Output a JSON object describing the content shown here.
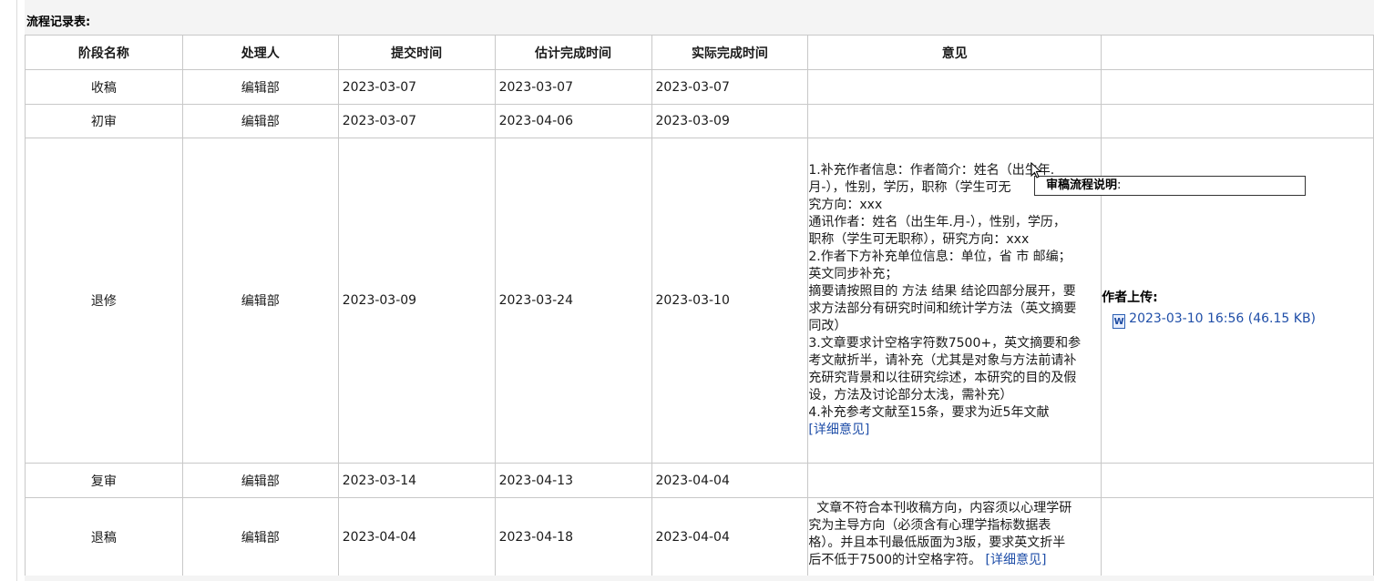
{
  "section_title": "流程记录表:",
  "columns": [
    "阶段名称",
    "处理人",
    "提交时间",
    "估计完成时间",
    "实际完成时间",
    "意见",
    ""
  ],
  "rows": [
    {
      "stage": "收稿",
      "handler": "编辑部",
      "submitted": "2023-03-07",
      "estimated": "2023-03-07",
      "actual": "2023-03-07"
    },
    {
      "stage": "初审",
      "handler": "编辑部",
      "submitted": "2023-03-07",
      "estimated": "2023-04-06",
      "actual": "2023-03-09"
    },
    {
      "stage": "退修",
      "handler": "编辑部",
      "submitted": "2023-03-09",
      "estimated": "2023-03-24",
      "actual": "2023-03-10",
      "opinion_lines": [
        "1.补充作者信息：作者简介：姓名（出生年.",
        "月-），性别，学历，职称（学生可无",
        "究方向：xxx",
        "通讯作者：姓名（出生年.月-），性别，学历，",
        "职称（学生可无职称），研究方向：xxx",
        "2.作者下方补充单位信息：单位，省 市 邮编；",
        "英文同步补充；",
        "摘要请按照目的 方法 结果 结论四部分展开，要",
        "求方法部分有研究时间和统计学方法（英文摘要",
        "同改）",
        "3.文章要求计空格字符数7500+，英文摘要和参",
        "考文献折半，请补充（尤其是对象与方法前请补",
        "充研究背景和以往研究综述，本研究的目的及假",
        "设，方法及讨论部分太浅，需补充）",
        "4.补充参考文献至15条，要求为近5年文献"
      ],
      "detail_link": "[详细意见]",
      "upload_label": "作者上传:",
      "upload_file": "2023-03-10 16:56 (46.15 KB)",
      "upload_icon": "word-doc-icon"
    },
    {
      "stage": "复审",
      "handler": "编辑部",
      "submitted": "2023-03-14",
      "estimated": "2023-04-13",
      "actual": "2023-04-04"
    },
    {
      "stage": "退稿",
      "handler": "编辑部",
      "submitted": "2023-04-04",
      "estimated": "2023-04-18",
      "actual": "2023-04-04",
      "opinion_lines": [
        "  文章不符合本刊收稿方向，内容须以心理学研",
        "究为主导方向（必须含有心理学指标数据表",
        "格）。并且本刊最低版面为3版，要求英文折半",
        "后不低于7500的计空格字符。"
      ],
      "detail_link": "[详细意见]"
    }
  ],
  "tooltip": {
    "title": "审稿流程说明",
    "suffix": ":"
  },
  "colors": {
    "link": "#1f4ea8",
    "border": "#c8c8c8",
    "panel": "#f4f4f4"
  }
}
